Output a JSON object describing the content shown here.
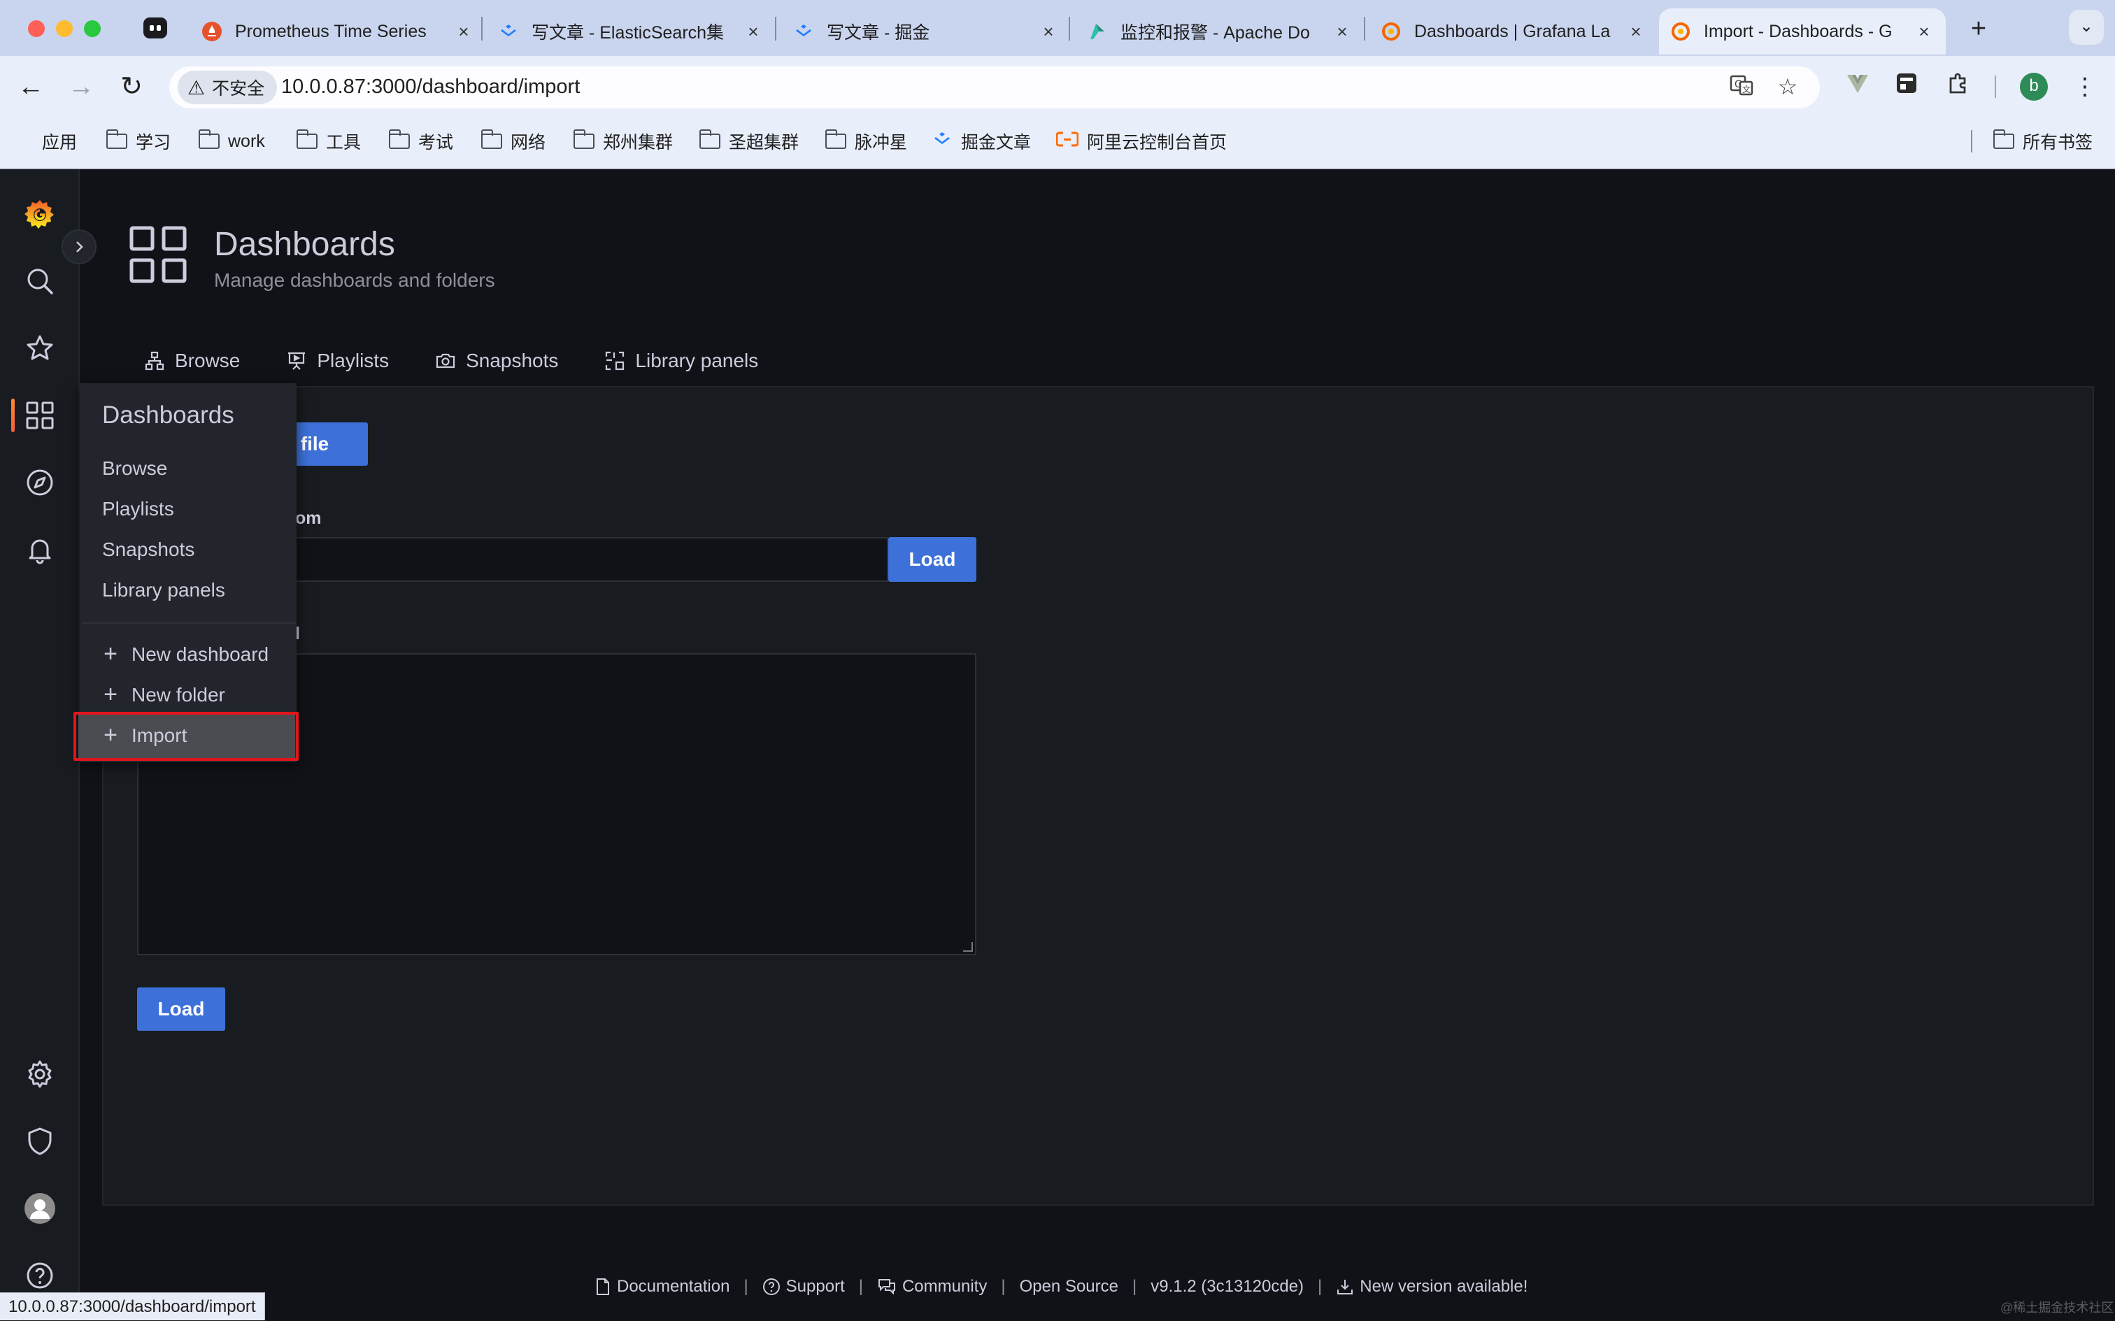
{
  "browser": {
    "tabs": [
      {
        "title": "Prometheus Time Series",
        "icon": "prometheus-icon"
      },
      {
        "title": "写文章 - ElasticSearch集",
        "icon": "juejin-icon"
      },
      {
        "title": "写文章 - 掘金",
        "icon": "juejin-icon"
      },
      {
        "title": "监控和报警 - Apache Do",
        "icon": "dolphinscheduler-icon"
      },
      {
        "title": "Dashboards | Grafana La",
        "icon": "grafana-icon"
      },
      {
        "title": "Import - Dashboards - G",
        "icon": "grafana-icon"
      }
    ],
    "new_tab": "+",
    "close": "×",
    "security_chip": "不安全",
    "url": "10.0.0.87:3000/dashboard/import",
    "profile_initial": "b",
    "bookmarks": [
      {
        "label": "应用",
        "icon": "apps-grid-icon"
      },
      {
        "label": "学习",
        "icon": "folder-icon"
      },
      {
        "label": "work",
        "icon": "folder-icon"
      },
      {
        "label": "工具",
        "icon": "folder-icon"
      },
      {
        "label": "考试",
        "icon": "folder-icon"
      },
      {
        "label": "网络",
        "icon": "folder-icon"
      },
      {
        "label": "郑州集群",
        "icon": "folder-icon"
      },
      {
        "label": "圣超集群",
        "icon": "folder-icon"
      },
      {
        "label": "脉冲星",
        "icon": "folder-icon"
      },
      {
        "label": "掘金文章",
        "icon": "juejin-icon"
      },
      {
        "label": "阿里云控制台首页",
        "icon": "aliyun-icon"
      }
    ],
    "all_bookmarks": "所有书签",
    "status_url": "10.0.0.87:3000/dashboard/import"
  },
  "page": {
    "title": "Dashboards",
    "subtitle": "Manage dashboards and folders",
    "tabs": [
      {
        "label": "Browse",
        "icon": "sitemap-icon"
      },
      {
        "label": "Playlists",
        "icon": "presentation-icon"
      },
      {
        "label": "Snapshots",
        "icon": "camera-icon"
      },
      {
        "label": "Library panels",
        "icon": "library-panel-icon"
      }
    ],
    "upload_button_visible": "N file",
    "url_label_visible": "om",
    "load_label": "Load",
    "json_label_visible": "l"
  },
  "dropdown": {
    "header": "Dashboards",
    "items": [
      "Browse",
      "Playlists",
      "Snapshots",
      "Library panels"
    ],
    "actions": [
      "New dashboard",
      "New folder",
      "Import"
    ],
    "plus": "+"
  },
  "footer": {
    "documentation": "Documentation",
    "support": "Support",
    "community": "Community",
    "open_source": "Open Source",
    "version": "v9.1.2 (3c13120cde)",
    "new_version": "New version available!",
    "separator": "|"
  },
  "watermark": "@稀土掘金技术社区",
  "colors": {
    "primary_button": "#3d71d9",
    "grafana_orange": "#f55f3e",
    "highlight_border": "#e0161c"
  }
}
